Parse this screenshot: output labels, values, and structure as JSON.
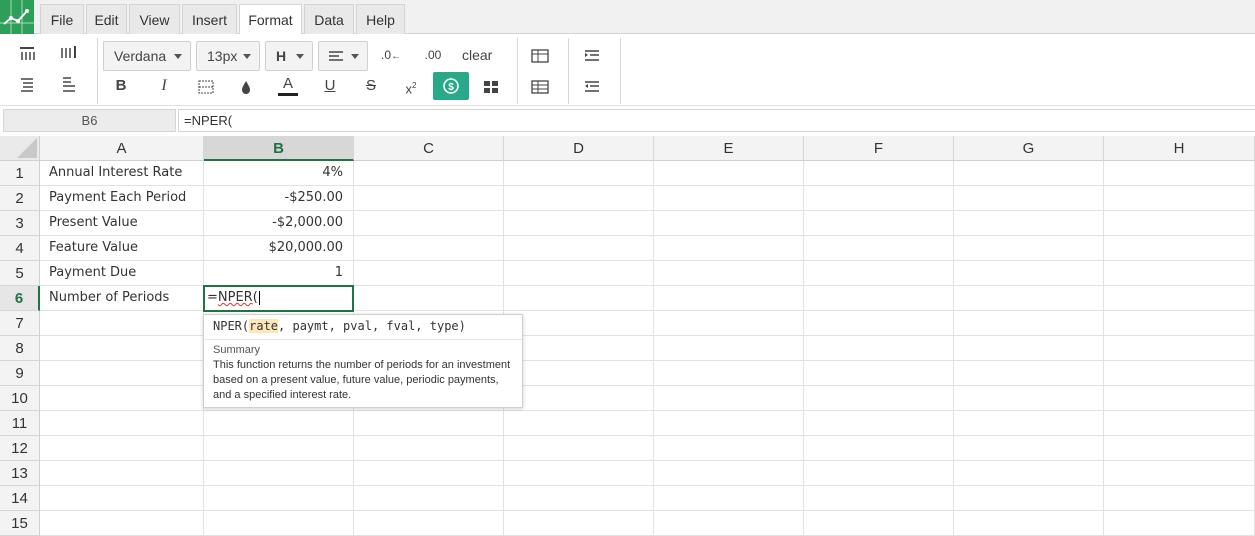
{
  "menu": {
    "items": [
      "File",
      "Edit",
      "View",
      "Insert",
      "Format",
      "Data",
      "Help"
    ],
    "active": "Format"
  },
  "toolbar": {
    "font_family": "Verdana",
    "font_size": "13px",
    "clear_label": "clear",
    "accent_color": "#27a98a"
  },
  "formula_bar": {
    "name_box": "B6",
    "formula": "=NPER("
  },
  "grid": {
    "columns": [
      "A",
      "B",
      "C",
      "D",
      "E",
      "F",
      "G",
      "H"
    ],
    "rows": [
      "1",
      "2",
      "3",
      "4",
      "5",
      "6",
      "7",
      "8",
      "9",
      "10",
      "11",
      "12",
      "13",
      "14",
      "15"
    ],
    "selected_column": "B",
    "selected_row": "6",
    "cells": [
      {
        "label": "Annual Interest Rate",
        "value": "4%"
      },
      {
        "label": "Payment Each Period",
        "value": "-$250.00"
      },
      {
        "label": "Present Value",
        "value": "-$2,000.00"
      },
      {
        "label": "Feature Value",
        "value": "$20,000.00"
      },
      {
        "label": "Payment Due",
        "value": "1"
      },
      {
        "label": "Number of Periods",
        "value": ""
      }
    ],
    "active_cell": {
      "prefix": "=",
      "func": "NPER",
      "paren": "("
    }
  },
  "tooltip": {
    "sig_func": "NPER(",
    "sig_arg_current": "rate",
    "sig_rest": ", paymt, pval, fval, type)",
    "summary_label": "Summary",
    "description": "This function returns the number of periods for an investment based on a present value, future value, periodic payments, and a specified interest rate."
  },
  "colors": {
    "brand_green": "#2e9e5b",
    "selection_green": "#217346"
  }
}
